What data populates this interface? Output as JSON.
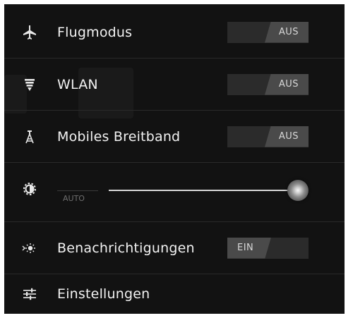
{
  "quick_settings": {
    "airplane": {
      "label": "Flugmodus",
      "toggle_text": "AUS",
      "icon": "airplane-icon"
    },
    "wifi": {
      "label": "WLAN",
      "toggle_text": "AUS",
      "icon": "wifi-icon"
    },
    "mobile": {
      "label": "Mobiles Breitband",
      "toggle_text": "AUS",
      "icon": "antenna-icon"
    },
    "brightness": {
      "auto_label": "AUTO",
      "level": 1.0,
      "icon": "brightness-icon"
    },
    "notifications": {
      "label": "Benachrichtigungen",
      "toggle_text": "EIN",
      "icon": "notification-icon"
    },
    "settings": {
      "label": "Einstellungen",
      "icon": "settings-sliders-icon"
    }
  },
  "colors": {
    "panel_bg": "#121212",
    "text": "#f2f2f2",
    "toggle_track": "#2b2b2b",
    "toggle_thumb": "#4a4a4a"
  }
}
